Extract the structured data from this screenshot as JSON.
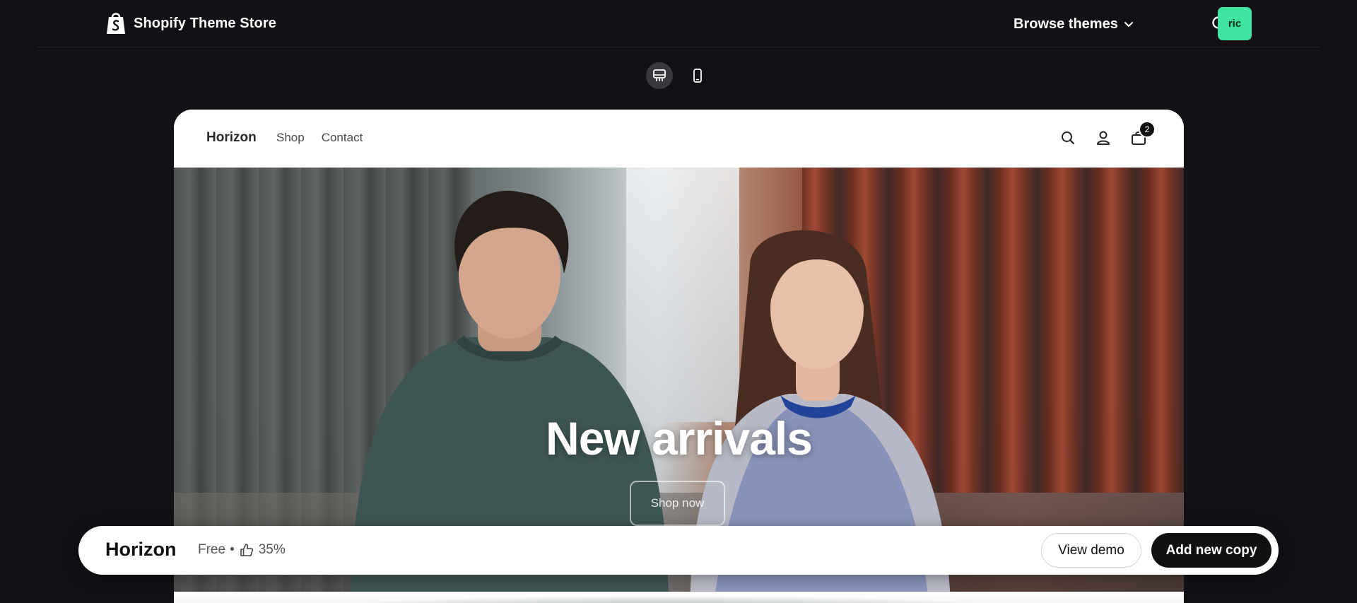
{
  "header": {
    "brand_name": "Shopify Theme Store",
    "browse_label": "Browse themes",
    "avatar_initials": "ric",
    "avatar_color": "#3fe4a0"
  },
  "device_toggle": {
    "options": [
      {
        "icon": "desktop-icon",
        "active": true
      },
      {
        "icon": "mobile-icon",
        "active": false
      }
    ]
  },
  "preview": {
    "store_name": "Horizon",
    "nav_links": [
      "Shop",
      "Contact"
    ],
    "cart_count": "2",
    "hero_title": "New arrivals",
    "hero_button": "Shop now"
  },
  "theme_bar": {
    "name": "Horizon",
    "price": "Free",
    "separator": "•",
    "rating": "35%",
    "view_demo_label": "View demo",
    "add_copy_label": "Add new copy"
  }
}
